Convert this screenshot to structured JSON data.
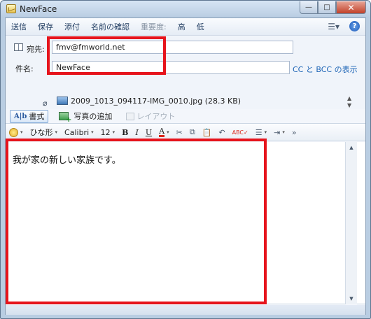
{
  "window": {
    "title": "NewFace"
  },
  "window_controls": {
    "minimize": "—",
    "maximize": "□",
    "close": "✕"
  },
  "menubar": {
    "items": [
      "送信",
      "保存",
      "添付",
      "名前の確認",
      "重要度:",
      "高",
      "低"
    ]
  },
  "header": {
    "to_label": "宛先:",
    "to_value": "fmv@fmworld.net",
    "subject_label": "件名:",
    "subject_value": "NewFace",
    "cc_bcc_link": "CC と BCC の表示"
  },
  "attachment": {
    "filename": "2009_1013_094117-IMG_0010.jpg (28.3 KB)"
  },
  "toolbar2": {
    "format_label": "書式",
    "add_photo_label": "写真の追加",
    "layout_label": "レイアウト"
  },
  "format_bar": {
    "font_style": "ひな形",
    "font_name": "Calibri",
    "font_size": "12"
  },
  "message": {
    "body": "我が家の新しい家族です。"
  },
  "colors": {
    "highlight_box": "#e6141c",
    "link": "#1b63b5"
  }
}
